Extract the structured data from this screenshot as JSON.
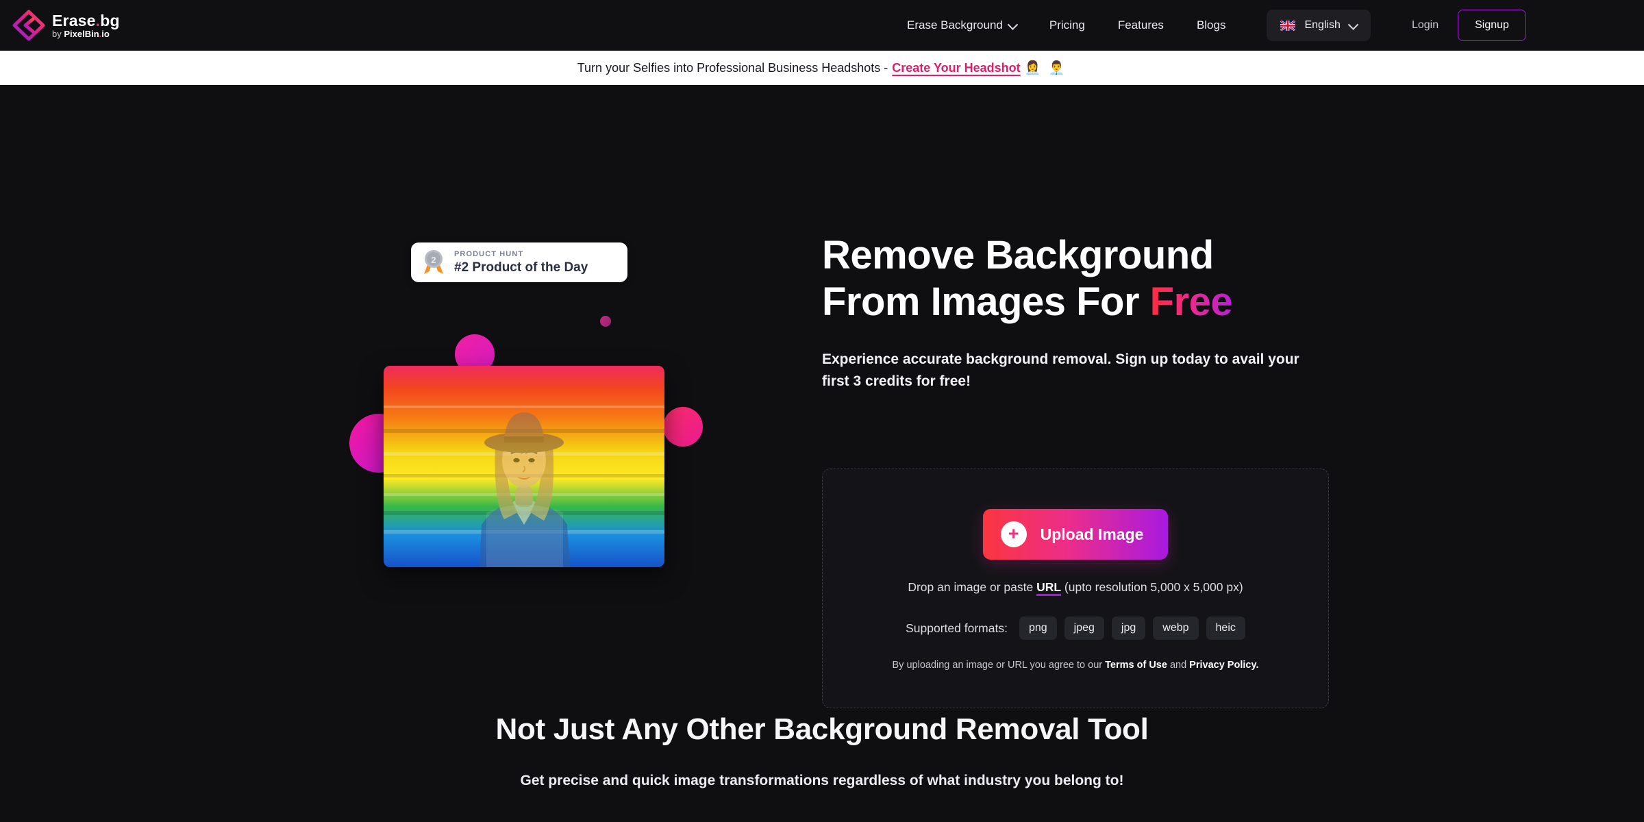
{
  "brand": {
    "name": "Erase",
    "name_dot": ".",
    "name_tld": "bg",
    "by_prefix": "by ",
    "by_name": "PixelBin",
    "by_dot": ".",
    "by_tld": "io",
    "logo_icon": "erasebg-diamond-logo"
  },
  "nav": {
    "items": [
      {
        "label": "Erase Background",
        "has_dropdown": true,
        "icon": "chevron-down-icon"
      },
      {
        "label": "Pricing",
        "has_dropdown": false
      },
      {
        "label": "Features",
        "has_dropdown": false
      },
      {
        "label": "Blogs",
        "has_dropdown": false
      }
    ],
    "language": {
      "label": "English",
      "flag_icon": "uk-flag-icon",
      "chevron_icon": "chevron-down-icon"
    },
    "login_label": "Login",
    "signup_label": "Signup",
    "signup_border_color": "#a21bd6"
  },
  "promo": {
    "text": "Turn your Selfies into Professional Business Headshots -",
    "link_label": "Create Your Headshot",
    "emoji": "👩‍💼 👨‍💼",
    "link_color": "#e31b6d",
    "background": "#ffffff"
  },
  "hero": {
    "product_hunt": {
      "kicker": "PRODUCT HUNT",
      "title": "#2 Product of the Day",
      "medal_icon": "silver-medal-icon"
    },
    "headline_line1": "Remove Background",
    "headline_line2_prefix": "From Images For ",
    "headline_highlight": "Free",
    "highlight_gradient": "#ff2d3f → #b81fd4",
    "subheadline": "Experience accurate background removal. Sign up today to avail your first 3 credits for free!",
    "photo_alt": "woman-in-hat-rainbow-background"
  },
  "upload": {
    "button_label": "Upload Image",
    "button_icon": "plus-circle-icon",
    "button_gradient": "#fb3640 → #a81ae0",
    "drop_prefix": "Drop an image or paste ",
    "drop_link": "URL",
    "drop_suffix": " (upto resolution 5,000 x 5,000 px)",
    "formats_label": "Supported formats:",
    "formats": [
      "png",
      "jpeg",
      "jpg",
      "webp",
      "heic"
    ],
    "terms_prefix": "By uploading an image or URL you agree to our ",
    "terms_link": "Terms of Use",
    "terms_mid": " and ",
    "privacy_link": "Privacy Policy."
  },
  "section2": {
    "title": "Not Just Any Other Background Removal Tool",
    "subtitle": "Get precise and quick image transformations regardless of what industry you belong to!"
  }
}
